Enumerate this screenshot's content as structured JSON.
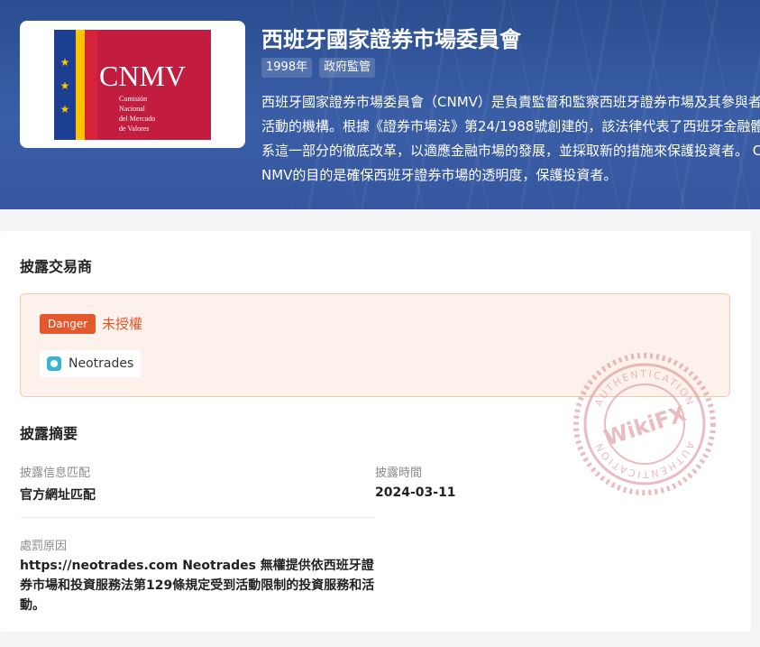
{
  "regulator": {
    "logo": {
      "name": "CNMV",
      "line1": "Comisión",
      "line2": "Nacional",
      "line3": "del Mercado",
      "line4": "de Valores"
    },
    "title": "西班牙國家證券市場委員會",
    "tags": [
      "1998年",
      "政府監管"
    ],
    "description": "西班牙國家證券市場委員會（CNMV）是負責監督和監察西班牙證券市場及其參與者活動的機構。根據《證券市場法》第24/1988號創建的，該法律代表了西班牙金融體系這一部分的徹底改革，以適應金融市場的發展，並採取新的措施來保護投資者。 CNMV的目的是確保西班牙證券市場的透明度，保護投資者。"
  },
  "disclosure": {
    "section_title": "披露交易商",
    "badge": "Danger",
    "status": "未授權",
    "trader": "Neotrades"
  },
  "summary": {
    "section_title": "披露摘要",
    "match_label": "披露信息匹配",
    "match_value": "官方網址匹配",
    "time_label": "披露時間",
    "time_value": "2024-03-11",
    "reason_label": "處罰原因",
    "reason_value": "https://neotrades.com Neotrades 無權提供依西班牙證券市場和投資服務法第129條規定受到活動限制的投資服務和活動。"
  },
  "watermark": {
    "brand": "WikiFX",
    "ring_text": "AUTHENTICATION"
  },
  "colors": {
    "banner": "#3a5ea6",
    "danger": "#e4582b",
    "highlight": "#f7cf45",
    "logo_red": "#c8102e",
    "logo_yellow": "#ffc400",
    "logo_blue": "#1c3f94"
  }
}
